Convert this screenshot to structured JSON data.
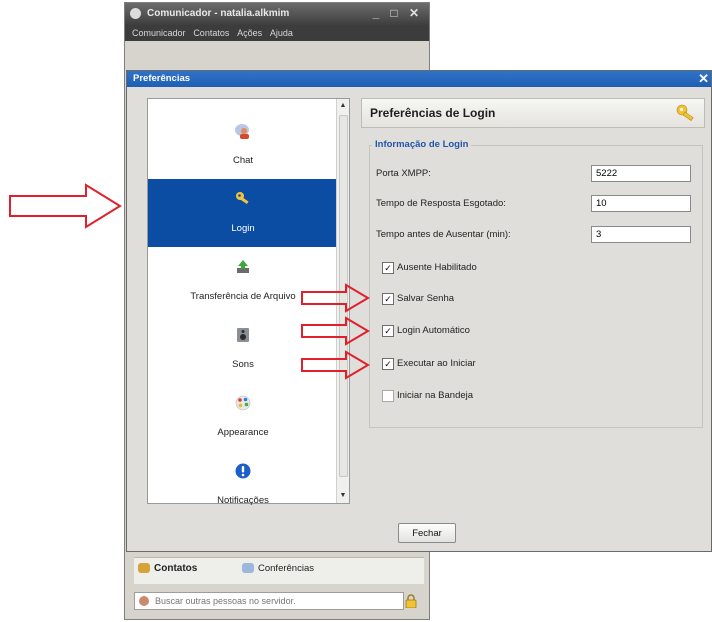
{
  "main_window": {
    "title": "Comunicador - natalia.alkmim",
    "controls": {
      "minimize": "_",
      "maximize": "□",
      "close": "✕"
    },
    "menu": [
      "Comunicador",
      "Contatos",
      "Ações",
      "Ajuda"
    ],
    "tabs": [
      {
        "label": "Contatos",
        "active": true
      },
      {
        "label": "Conferências",
        "active": false
      }
    ],
    "search": {
      "placeholder": "Buscar outras pessoas no servidor."
    }
  },
  "preferences": {
    "title": "Preferências",
    "close": "✕",
    "categories": [
      {
        "label": "Chat",
        "icon": "chat-user-icon",
        "selected": false
      },
      {
        "label": "Login",
        "icon": "key-icon",
        "selected": true
      },
      {
        "label": "Transferência de Arquivo",
        "icon": "file-transfer-icon",
        "selected": false
      },
      {
        "label": "Sons",
        "icon": "speaker-icon",
        "selected": false
      },
      {
        "label": "Appearance",
        "icon": "palette-icon",
        "selected": false
      },
      {
        "label": "Notificações",
        "icon": "info-icon",
        "selected": false
      }
    ],
    "panel": {
      "title": "Preferências de Login",
      "group_title": "Informação de Login",
      "fields": [
        {
          "label": "Porta XMPP:",
          "value": "5222"
        },
        {
          "label": "Tempo de Resposta Esgotado:",
          "value": "10"
        },
        {
          "label": "Tempo antes de Ausentar (min):",
          "value": "3"
        }
      ],
      "checkboxes": [
        {
          "label": "Ausente Habilitado",
          "checked": true
        },
        {
          "label": "Salvar Senha",
          "checked": true
        },
        {
          "label": "Login Automático",
          "checked": true
        },
        {
          "label": "Executar ao Iniciar",
          "checked": true
        },
        {
          "label": "Iniciar na Bandeja",
          "checked": false
        }
      ]
    },
    "close_button": "Fechar"
  },
  "colors": {
    "selection": "#0b4da3",
    "dialog_titlebar": "#2f73c9",
    "annotation_arrow": "#e0202a",
    "group_title": "#2255aa"
  }
}
